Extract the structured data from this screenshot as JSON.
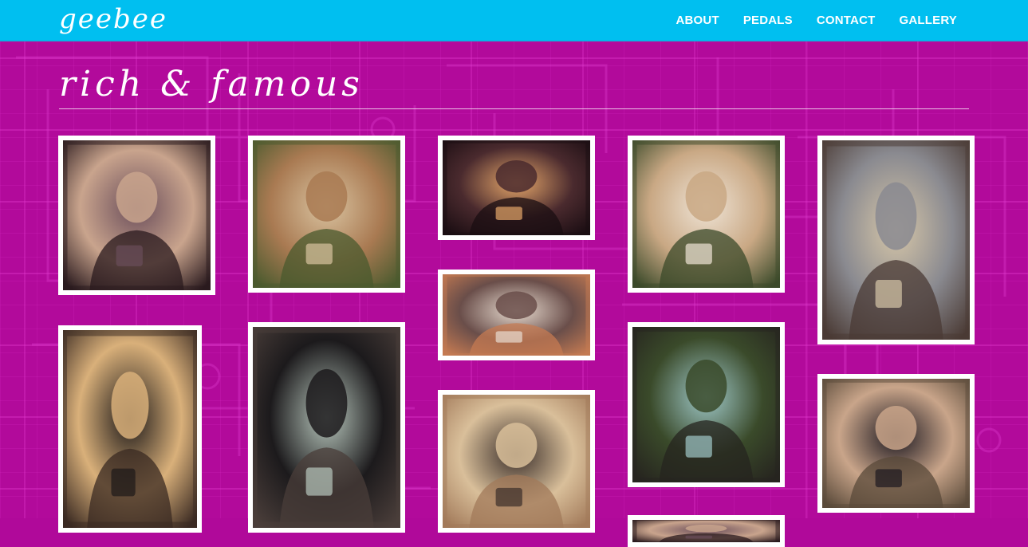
{
  "site": {
    "logo": "geebee",
    "nav": [
      {
        "label": "ABOUT"
      },
      {
        "label": "PEDALS"
      },
      {
        "label": "CONTACT"
      },
      {
        "label": "GALLERY"
      }
    ]
  },
  "page": {
    "title": "rich & famous"
  },
  "colors": {
    "navbar": "#00bff0",
    "background": "#b0099a",
    "frame": "#ffffff"
  },
  "gallery": [
    {
      "name": "photo-man-towel-pedal",
      "tone": [
        "#2a1a1e",
        "#c9a48d",
        "#6a4d5a"
      ]
    },
    {
      "name": "photo-man-harmonica-pedal",
      "tone": [
        "#4a5a2e",
        "#a97a52",
        "#d9c3a0"
      ]
    },
    {
      "name": "photo-stage-guitarist-night",
      "tone": [
        "#1a0d12",
        "#4a2a2e",
        "#e6a76a"
      ]
    },
    {
      "name": "photo-bearded-man-pedal",
      "tone": [
        "#3b4a2a",
        "#c9a884",
        "#efe4d6"
      ]
    },
    {
      "name": "photo-man-two-pedals",
      "tone": [
        "#4a3a34",
        "#8a8a90",
        "#d6c6a8"
      ]
    },
    {
      "name": "photo-man-cap-sunglasses-pedal",
      "tone": [
        "#3a2a22",
        "#d9b07a",
        "#1c1818"
      ]
    },
    {
      "name": "photo-man-cap-pointing-pedal",
      "tone": [
        "#4a3e3a",
        "#1c1a1c",
        "#b8c7bd"
      ]
    },
    {
      "name": "photo-stage-crowd-performer",
      "tone": [
        "#c47a52",
        "#6a4e4a",
        "#e8dcd0"
      ]
    },
    {
      "name": "photo-man-sunglasses-cap-pedal",
      "tone": [
        "#26241f",
        "#3a4a2a",
        "#9fc8c8"
      ]
    },
    {
      "name": "photo-man-room-portrait",
      "tone": [
        "#a27a5a",
        "#d9bf9a",
        "#3a2e2a"
      ]
    },
    {
      "name": "photo-bearded-man-black-pedal",
      "tone": [
        "#5a4a3a",
        "#c9a58a",
        "#1c1820"
      ]
    }
  ]
}
